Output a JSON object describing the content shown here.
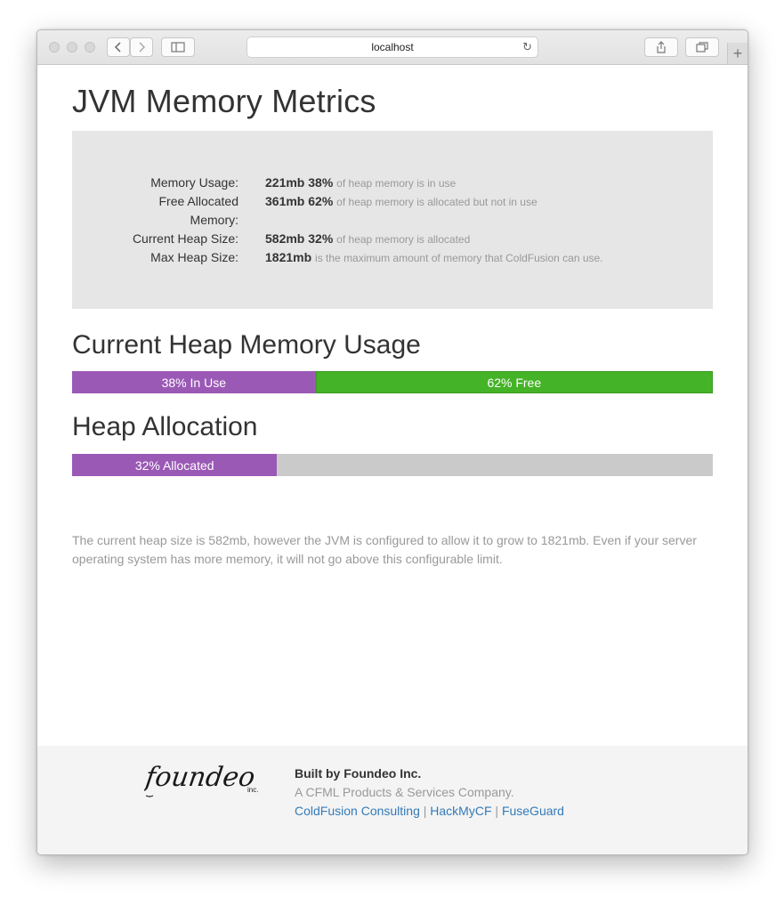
{
  "browser": {
    "url": "localhost"
  },
  "page": {
    "title": "JVM Memory Metrics"
  },
  "metrics": [
    {
      "label": "Memory Usage:",
      "value": "221mb",
      "percent": "38%",
      "description": "of heap memory is in use"
    },
    {
      "label": "Free Allocated Memory:",
      "value": "361mb",
      "percent": "62%",
      "description": "of heap memory is allocated but not in use"
    },
    {
      "label": "Current Heap Size:",
      "value": "582mb",
      "percent": "32%",
      "description": "of heap memory is allocated"
    },
    {
      "label": "Max Heap Size:",
      "value": "1821mb",
      "percent": "",
      "description": "is the maximum amount of memory that ColdFusion can use."
    }
  ],
  "heap_usage": {
    "heading": "Current Heap Memory Usage",
    "used_label": "38% In Use",
    "free_label": "62% Free",
    "used_fraction": 0.38,
    "colors": {
      "used": "#9b59b6",
      "free": "#44b327"
    }
  },
  "heap_allocation": {
    "heading": "Heap Allocation",
    "allocated_label": "32% Allocated",
    "allocated_fraction": 0.32,
    "colors": {
      "allocated": "#9b59b6",
      "remaining": "#cacaca"
    }
  },
  "note": "The current heap size is 582mb, however the JVM is configured to allow it to grow to 1821mb. Even if your server operating system has more memory, it will not go above this configurable limit.",
  "footer": {
    "logo_text": "foundeo",
    "logo_sub": "inc.",
    "built_by": "Built by Foundeo Inc.",
    "tagline": "A CFML Products & Services Company.",
    "links": [
      "ColdFusion Consulting",
      "HackMyCF",
      "FuseGuard"
    ],
    "separator": "|"
  }
}
